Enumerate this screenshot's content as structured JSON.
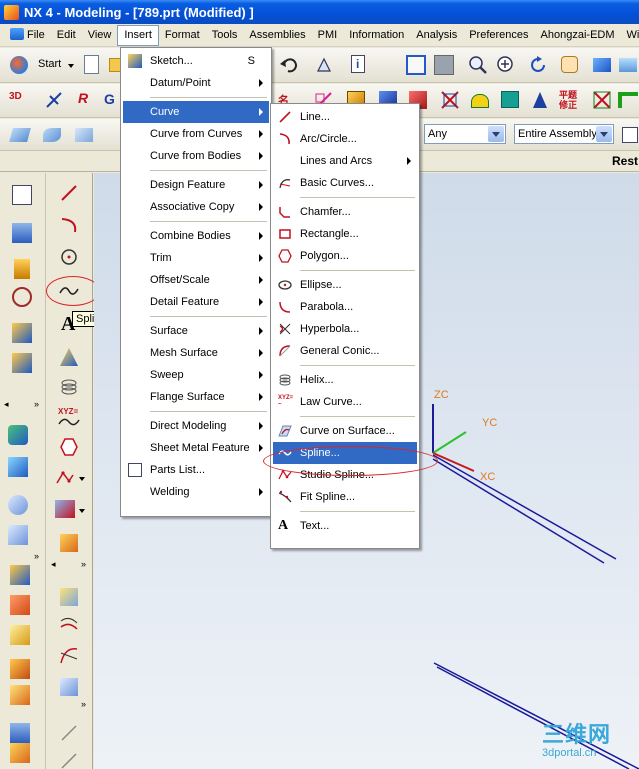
{
  "window": {
    "title": "NX 4 - Modeling - [789.prt (Modified) ]"
  },
  "menubar": {
    "items": [
      "File",
      "Edit",
      "View",
      "Insert",
      "Format",
      "Tools",
      "Assemblies",
      "PMI",
      "Information",
      "Analysis",
      "Preferences",
      "Ahongzai-EDM",
      "Win"
    ]
  },
  "toolbar": {
    "start_label": "Start",
    "filter_value": "Any",
    "scope_value": "Entire Assembly",
    "rest_label": "Rest"
  },
  "insert_menu": {
    "items": [
      {
        "label": "Sketch...",
        "shortcut": "S"
      },
      {
        "label": "Datum/Point"
      },
      {
        "label": "Curve"
      },
      {
        "label": "Curve from Curves"
      },
      {
        "label": "Curve from Bodies"
      },
      {
        "label": "Design Feature"
      },
      {
        "label": "Associative Copy"
      },
      {
        "label": "Combine Bodies"
      },
      {
        "label": "Trim"
      },
      {
        "label": "Offset/Scale"
      },
      {
        "label": "Detail Feature"
      },
      {
        "label": "Surface"
      },
      {
        "label": "Mesh Surface"
      },
      {
        "label": "Sweep"
      },
      {
        "label": "Flange Surface"
      },
      {
        "label": "Direct Modeling"
      },
      {
        "label": "Sheet Metal Feature"
      },
      {
        "label": "Parts List..."
      },
      {
        "label": "Welding"
      }
    ]
  },
  "curve_submenu": {
    "items": [
      {
        "label": "Line..."
      },
      {
        "label": "Arc/Circle..."
      },
      {
        "label": "Lines and Arcs"
      },
      {
        "label": "Basic Curves..."
      },
      {
        "label": "Chamfer..."
      },
      {
        "label": "Rectangle..."
      },
      {
        "label": "Polygon..."
      },
      {
        "label": "Ellipse..."
      },
      {
        "label": "Parabola..."
      },
      {
        "label": "Hyperbola..."
      },
      {
        "label": "General Conic..."
      },
      {
        "label": "Helix..."
      },
      {
        "label": "Law Curve..."
      },
      {
        "label": "Curve on Surface..."
      },
      {
        "label": "Spline..."
      },
      {
        "label": "Studio Spline..."
      },
      {
        "label": "Fit Spline..."
      },
      {
        "label": "Text..."
      }
    ]
  },
  "tooltip": {
    "text": "Spline"
  },
  "viewport": {
    "axes": {
      "zc": "ZC",
      "yc": "YC",
      "xc": "XC"
    }
  },
  "watermark": {
    "title": "三维网",
    "url": "3dportal.cn"
  },
  "colors": {
    "highlight": "#316ac5",
    "annotation": "#d9262b",
    "axis_label": "#e07a1a"
  }
}
